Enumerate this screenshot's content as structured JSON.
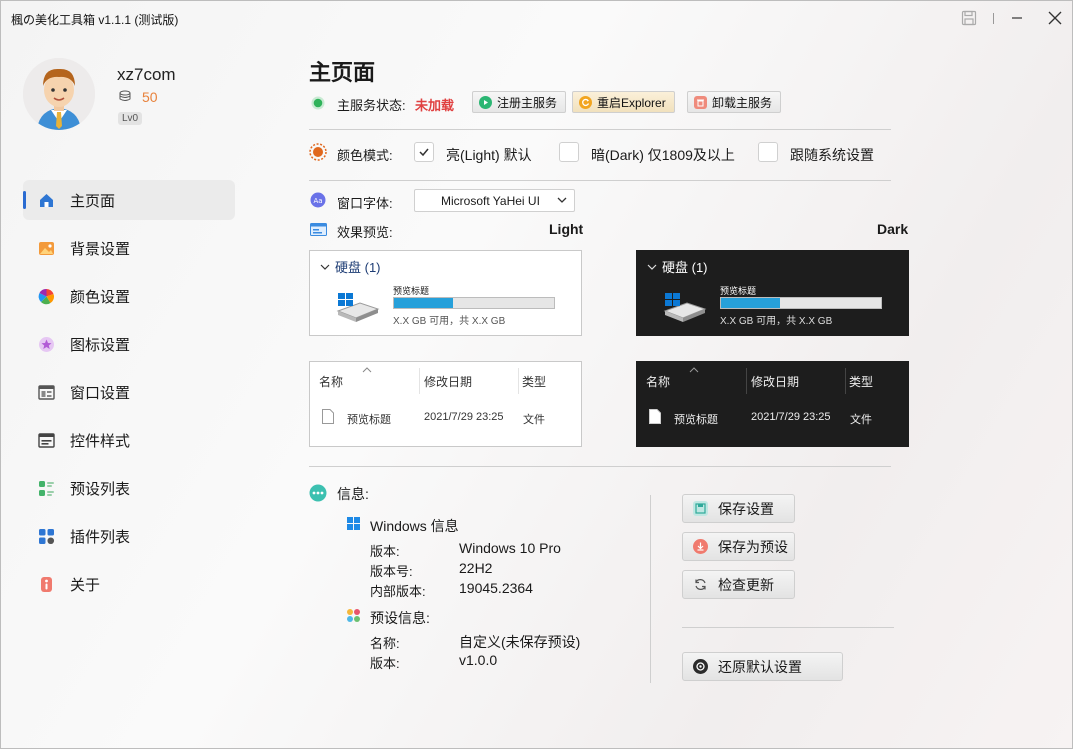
{
  "window": {
    "title": "楓の美化工具箱 v1.1.1 (测试版)"
  },
  "user": {
    "name": "xz7com",
    "coins": "50",
    "level": "Lv0"
  },
  "sidebar": {
    "items": [
      {
        "label": "主页面",
        "icon": "home-icon",
        "active": true
      },
      {
        "label": "背景设置",
        "icon": "picture-icon"
      },
      {
        "label": "颜色设置",
        "icon": "color-wheel-icon"
      },
      {
        "label": "图标设置",
        "icon": "star-badge-icon"
      },
      {
        "label": "窗口设置",
        "icon": "window-icon"
      },
      {
        "label": "控件样式",
        "icon": "controls-icon"
      },
      {
        "label": "预设列表",
        "icon": "preset-list-icon"
      },
      {
        "label": "插件列表",
        "icon": "plugins-icon"
      },
      {
        "label": "关于",
        "icon": "info-icon"
      }
    ]
  },
  "main": {
    "title": "主页面",
    "service": {
      "label": "主服务状态:",
      "status": "未加载",
      "status_color": "#e04040",
      "buttons": {
        "register": "注册主服务",
        "restart": "重启Explorer",
        "uninstall": "卸载主服务"
      }
    },
    "color_mode": {
      "label": "颜色模式:",
      "options": [
        {
          "label": "亮(Light) 默认",
          "checked": true
        },
        {
          "label": "暗(Dark) 仅1809及以上",
          "checked": false
        },
        {
          "label": "跟随系统设置",
          "checked": false
        }
      ]
    },
    "font": {
      "label": "窗口字体:",
      "value": "Microsoft YaHei UI"
    },
    "preview": {
      "label": "效果预览:",
      "light_label": "Light",
      "dark_label": "Dark",
      "disk_header": "硬盘 (1)",
      "disk_name": "预览标题",
      "disk_fill": 0.37,
      "disk_free": "X.X GB 可用，共 X.X GB",
      "list_headers": [
        "名称",
        "修改日期",
        "类型"
      ],
      "row": {
        "name": "预览标题",
        "date": "2021/7/29 23:25",
        "type": "文件"
      }
    },
    "info": {
      "label": "信息:",
      "windows": {
        "title": "Windows 信息",
        "rows": [
          {
            "key": "版本:",
            "value": "Windows 10 Pro"
          },
          {
            "key": "版本号:",
            "value": "22H2"
          },
          {
            "key": "内部版本:",
            "value": "19045.2364"
          }
        ]
      },
      "preset": {
        "title": "预设信息:",
        "rows": [
          {
            "key": "名称:",
            "value": "自定义(未保存预设)"
          },
          {
            "key": "版本:",
            "value": "v1.0.0"
          }
        ]
      }
    },
    "actions": {
      "save": "保存设置",
      "save_preset": "保存为预设",
      "check_update": "检查更新",
      "restore_default": "还原默认设置"
    }
  }
}
